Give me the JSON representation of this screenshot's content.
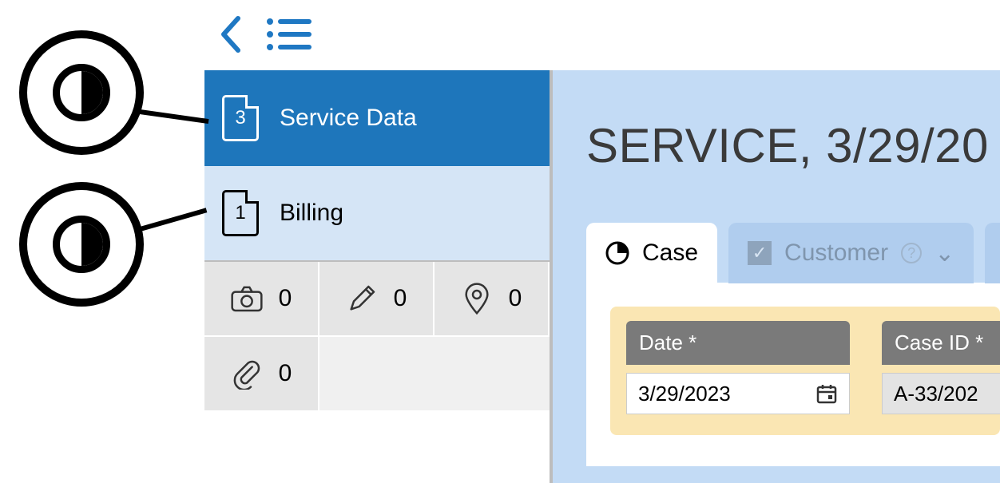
{
  "sidebar": {
    "items": [
      {
        "count": "3",
        "label": "Service Data"
      },
      {
        "count": "1",
        "label": "Billing"
      }
    ]
  },
  "counters": {
    "photo": "0",
    "pencil": "0",
    "pin": "0",
    "attach": "0"
  },
  "header": {
    "title_prefix": "SERVICE, ",
    "title_date": "3/29/20"
  },
  "tabs": {
    "case": "Case",
    "customer": "Customer"
  },
  "form": {
    "date_label": "Date *",
    "date_value": "3/29/2023",
    "caseid_label": "Case ID *",
    "caseid_value": "A-33/202"
  }
}
